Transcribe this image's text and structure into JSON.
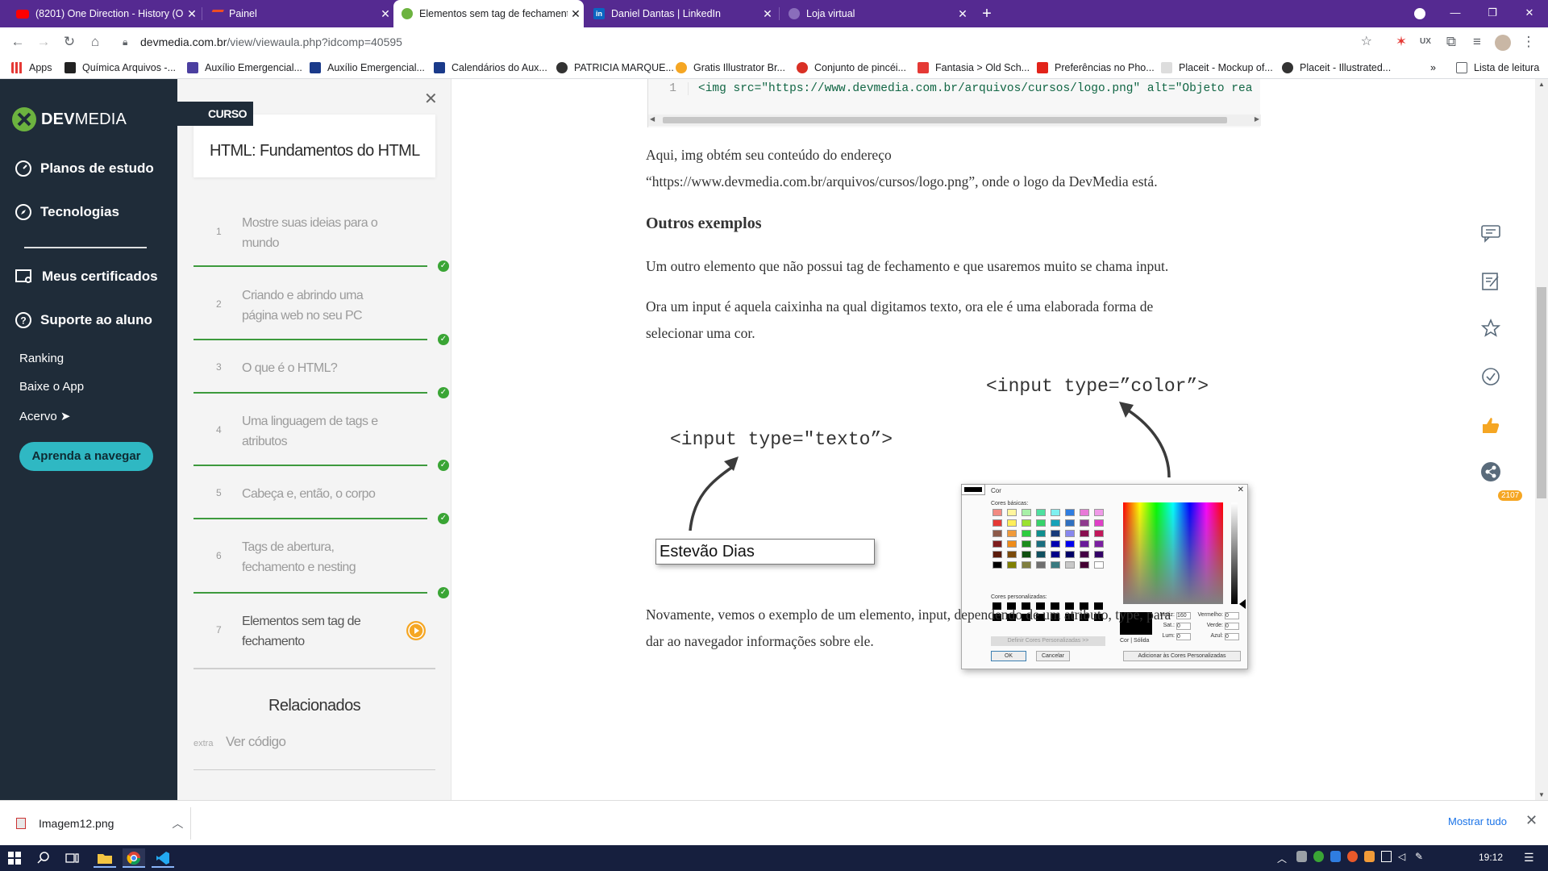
{
  "browser": {
    "tabs": [
      {
        "title": "(8201) One Direction - History (O",
        "favicon": "youtube-icon",
        "active": false
      },
      {
        "title": "Painel",
        "favicon": "hotmart-icon",
        "active": false
      },
      {
        "title": "Elementos sem tag de fechament",
        "favicon": "devmedia-icon",
        "active": true
      },
      {
        "title": "Daniel Dantas | LinkedIn",
        "favicon": "linkedin-icon",
        "active": false
      },
      {
        "title": "Loja virtual",
        "favicon": "globe-icon",
        "active": false
      }
    ],
    "url_host": "devmedia.com.br",
    "url_path": "/view/viewaula.php?idcomp=40595",
    "bookmarks": [
      "Apps",
      "Química Arquivos -...",
      "Auxílio Emergencial...",
      "Auxílio Emergencial...",
      "Calendários do Aux...",
      "PATRICIA MARQUE...",
      "Gratis Illustrator Br...",
      "Conjunto de pincéi...",
      "Fantasia > Old Sch...",
      "Preferências no Pho...",
      "Placeit - Mockup of...",
      "Placeit - Illustrated..."
    ],
    "bookmarks_more": "»",
    "reading_list": "Lista de leitura",
    "accent": "#552a91"
  },
  "sidebar": {
    "logo_dev": "DEV",
    "logo_media": "MEDIA",
    "nav": [
      {
        "label": "Planos de estudo",
        "icon": "gauge-icon"
      },
      {
        "label": "Tecnologias",
        "icon": "compass-icon"
      },
      {
        "label": "Meus certificados",
        "icon": "certificate-icon"
      },
      {
        "label": "Suporte ao aluno",
        "icon": "help-icon"
      }
    ],
    "sub": [
      "Ranking",
      "Baixe o App",
      "Acervo ➤"
    ],
    "button": "Aprenda a navegar"
  },
  "course": {
    "badge": "CURSO",
    "title": "HTML: Fundamentos do HTML",
    "close": "✕",
    "lessons": [
      {
        "num": "1",
        "title": "Mostre suas ideias para o mundo",
        "done": true
      },
      {
        "num": "2",
        "title": "Criando e abrindo uma página web no seu PC",
        "done": true
      },
      {
        "num": "3",
        "title": "O que é o HTML?",
        "done": true
      },
      {
        "num": "4",
        "title": "Uma linguagem de tags e atributos",
        "done": true
      },
      {
        "num": "5",
        "title": "Cabeça e, então, o corpo",
        "done": true
      },
      {
        "num": "6",
        "title": "Tags de abertura, fechamento e nesting",
        "done": true
      },
      {
        "num": "7",
        "title": "Elementos sem tag de fechamento",
        "done": false
      }
    ],
    "related_title": "Relacionados",
    "related_tag": "extra",
    "related_link": "Ver código"
  },
  "content": {
    "code_line_number": "1",
    "code": "<img src=\"https://www.devmedia.com.br/arquivos/cursos/logo.png\" alt=\"Objeto rea",
    "para1_line1": "Aqui, img obtém seu conteúdo do endereço",
    "para1_line2": "“https://www.devmedia.com.br/arquivos/cursos/logo.png”, onde o logo da DevMedia está.",
    "heading": "Outros exemplos",
    "para2": "Um outro elemento que não possui tag de fechamento e que usaremos muito se chama input.",
    "para3_line1": "Ora um input é aquela caixinha na qual digitamos texto, ora ele é uma elaborada forma de",
    "para3_line2": "selecionar uma cor.",
    "illus_color_label": "<input type=”color”>",
    "illus_text_label": "<input type=\"texto”>",
    "illus_text_value": "Estevão Dias",
    "dialog": {
      "title": "Cor",
      "basic_colors": "Cores básicas:",
      "custom_colors": "Cores personalizadas:",
      "define_button": "Definir Cores Personalizadas >>",
      "ok": "OK",
      "cancel": "Cancelar",
      "add_button": "Adicionar às Cores Personalizadas",
      "solid_label": "Cor | Sólida",
      "hue_label": "Matiz:",
      "hue_value": "160",
      "sat_label": "Sat.:",
      "sat_value": "0",
      "lum_label": "Lum:",
      "lum_value": "0",
      "red_label": "Vermelho:",
      "red_value": "0",
      "green_label": "Verde:",
      "green_value": "0",
      "blue_label": "Azul:",
      "blue_value": "0"
    },
    "para4_line1": "Novamente, vemos o exemplo de um elemento, input, dependendo de um atributo, type, para",
    "para4_line2": "dar ao navegador informações sobre ele."
  },
  "rail": {
    "like_count": "2107"
  },
  "download": {
    "file": "Imagem12.png",
    "show_all": "Mostrar tudo",
    "close": "✕"
  },
  "taskbar": {
    "time": "19:12"
  }
}
